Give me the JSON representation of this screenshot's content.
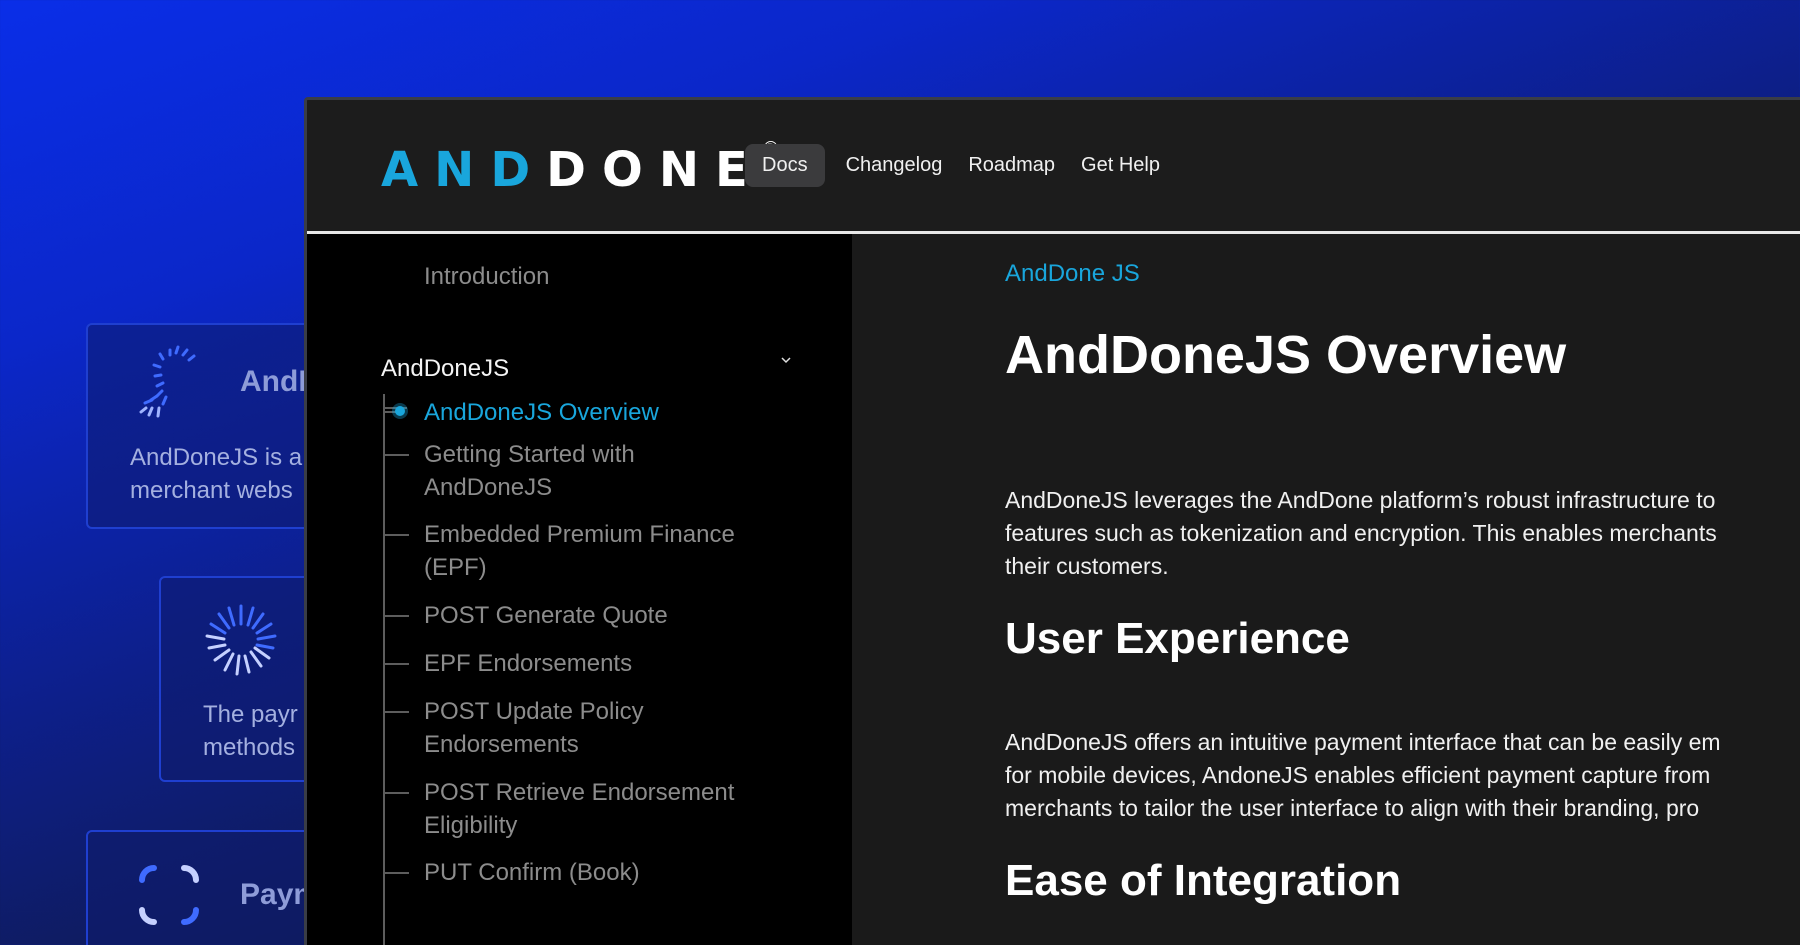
{
  "background_cards": [
    {
      "title": "AndD",
      "text_lines": [
        "AndDoneJS is a",
        "merchant webs"
      ],
      "icon": "radial-dots-icon"
    },
    {
      "title": "",
      "text_lines": [
        "The payr",
        "methods"
      ],
      "icon": "burst-icon"
    },
    {
      "title": "Paym",
      "text_lines": [],
      "icon": "corner-brackets-icon"
    }
  ],
  "header": {
    "logo_and": "AND",
    "logo_done": "DONE",
    "logo_reg": "®",
    "nav": [
      {
        "label": "Docs",
        "active": true
      },
      {
        "label": "Changelog",
        "active": false
      },
      {
        "label": "Roadmap",
        "active": false
      },
      {
        "label": "Get Help",
        "active": false
      }
    ]
  },
  "sidebar": {
    "intro": "Introduction",
    "group_label": "AndDoneJS",
    "items": [
      {
        "lines": [
          "AndDoneJS Overview"
        ],
        "active": true
      },
      {
        "lines": [
          "Getting Started with",
          "AndDoneJS"
        ],
        "active": false
      },
      {
        "lines": [
          "Embedded Premium Finance",
          "(EPF)"
        ],
        "active": false
      },
      {
        "lines": [
          "POST Generate Quote"
        ],
        "active": false
      },
      {
        "lines": [
          "EPF Endorsements"
        ],
        "active": false
      },
      {
        "lines": [
          "POST Update Policy",
          "Endorsements"
        ],
        "active": false
      },
      {
        "lines": [
          "POST Retrieve Endorsement",
          "Eligibility"
        ],
        "active": false
      },
      {
        "lines": [
          "PUT Confirm (Book)"
        ],
        "active": false
      }
    ]
  },
  "main": {
    "breadcrumb": "AndDone JS",
    "title": "AndDoneJS Overview",
    "intro_lines": [
      "AndDoneJS leverages the AndDone platform’s robust infrastructure to",
      "features such as tokenization and encryption. This enables merchants",
      "their customers."
    ],
    "section1_title": "User Experience",
    "section1_lines": [
      "AndDoneJS offers an intuitive payment interface that can be easily em",
      "for mobile devices, AndoneJS enables efficient payment capture from",
      "merchants to tailor the user interface to align with their branding, pro"
    ],
    "section2_title": "Ease of Integration"
  },
  "colors": {
    "accent": "#19a6dc",
    "sidebar_bg": "#000000",
    "content_bg": "#1a1a1a",
    "bg_blue": "#0a2ee8"
  }
}
